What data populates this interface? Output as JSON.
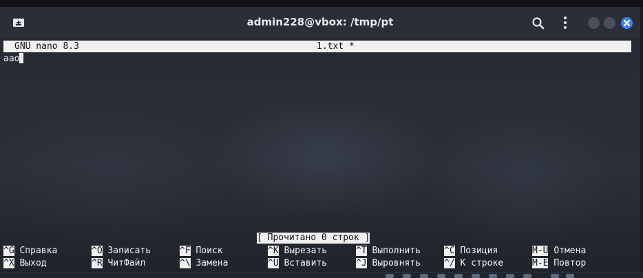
{
  "window": {
    "title": "admin228@vbox: /tmp/pt"
  },
  "icons": {
    "new_tab": "new-tab-icon",
    "search": "search-icon",
    "menu": "kebab-menu-icon",
    "minimize": "minimize-icon",
    "maximize": "maximize-icon",
    "close": "close-icon"
  },
  "colors": {
    "close_button": "#3b82f6",
    "nano_bar_bg": "#f0f0f0",
    "terminal_text": "#f2f2f2"
  },
  "nano": {
    "version": "GNU nano 8.3",
    "filename": "1.txt *",
    "buffer_text": "aao",
    "status_message": "[ Прочитано 0 строк ]",
    "shortcuts_row1": [
      {
        "key": "^G",
        "label": "Справка"
      },
      {
        "key": "^O",
        "label": "Записать"
      },
      {
        "key": "^F",
        "label": "Поиск"
      },
      {
        "key": "^K",
        "label": "Вырезать"
      },
      {
        "key": "^T",
        "label": "Выполнить"
      },
      {
        "key": "^C",
        "label": "Позиция"
      },
      {
        "key": "M-U",
        "label": "Отмена"
      }
    ],
    "shortcuts_row2": [
      {
        "key": "^X",
        "label": "Выход"
      },
      {
        "key": "^R",
        "label": "ЧитФайл"
      },
      {
        "key": "^\\",
        "label": "Замена"
      },
      {
        "key": "^U",
        "label": "Вставить"
      },
      {
        "key": "^J",
        "label": "Выровнять"
      },
      {
        "key": "^/",
        "label": "К строке"
      },
      {
        "key": "M-E",
        "label": "Повтор"
      }
    ]
  }
}
